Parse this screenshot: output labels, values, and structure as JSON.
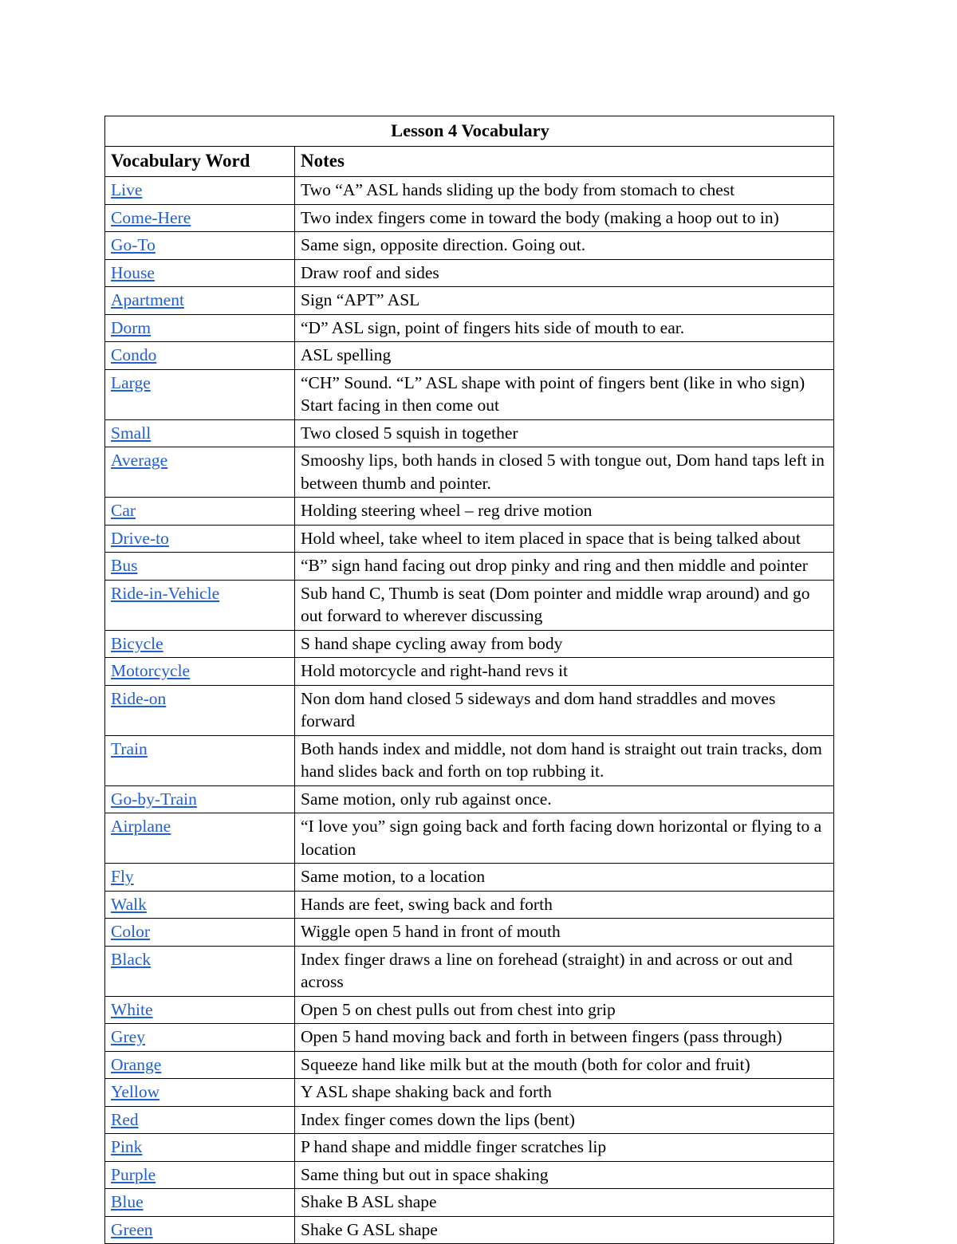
{
  "document": {
    "title": "Lesson 4 Vocabulary",
    "link_color": "#1f5fd0",
    "text_color": "#000000",
    "border_color": "#000000",
    "background_color": "#ffffff"
  },
  "table": {
    "title": "Lesson 4 Vocabulary",
    "columns": [
      {
        "label": "Vocabulary Word"
      },
      {
        "label": "Notes"
      }
    ],
    "rows": [
      {
        "word": "Live",
        "notes": "Two “A” ASL hands sliding up the body from stomach to chest"
      },
      {
        "word": "Come-Here",
        "notes": "Two index fingers come in toward the body (making a hoop out to in)"
      },
      {
        "word": "Go-To",
        "notes": "Same sign, opposite direction.  Going out."
      },
      {
        "word": "House",
        "notes": "Draw roof and sides"
      },
      {
        "word": "Apartment",
        "notes": "Sign “APT” ASL"
      },
      {
        "word": "Dorm",
        "notes": "“D” ASL sign, point of fingers hits side of mouth to ear."
      },
      {
        "word": "Condo",
        "notes": "ASL spelling"
      },
      {
        "word": "Large",
        "notes": "“CH” Sound. “L” ASL shape with point of fingers bent (like in who sign) Start facing in then come out"
      },
      {
        "word": "Small",
        "notes": "Two closed 5 squish in together"
      },
      {
        "word": "Average",
        "notes": "Smooshy lips, both hands in closed 5 with tongue out, Dom hand taps left in between thumb and pointer."
      },
      {
        "word": "Car",
        "notes": "Holding steering wheel – reg drive motion"
      },
      {
        "word": "Drive-to",
        "notes": "Hold wheel, take wheel to item placed in space that is being talked about"
      },
      {
        "word": "Bus",
        "notes": "“B” sign hand facing out drop pinky and ring and then middle and pointer"
      },
      {
        "word": "Ride-in-Vehicle",
        "notes": "Sub hand C, Thumb is seat (Dom pointer and middle wrap around) and go out forward to wherever discussing"
      },
      {
        "word": "Bicycle",
        "notes": "S hand shape cycling away from body"
      },
      {
        "word": "Motorcycle",
        "notes": "Hold motorcycle and right-hand revs it"
      },
      {
        "word": "Ride-on",
        "notes": "Non dom hand closed 5 sideways and dom hand straddles and moves forward"
      },
      {
        "word": "Train",
        "notes": "Both hands index and middle, not dom hand is straight out train tracks, dom hand slides back and forth on top rubbing it."
      },
      {
        "word": "Go-by-Train",
        "notes": "Same motion, only rub against once."
      },
      {
        "word": "Airplane",
        "notes": "“I love you” sign going back and forth facing down horizontal or flying to a location"
      },
      {
        "word": "Fly",
        "notes": "Same motion, to a location"
      },
      {
        "word": "Walk",
        "notes": "Hands are feet, swing back and forth"
      },
      {
        "word": "Color",
        "notes": "Wiggle open 5 hand in front of mouth"
      },
      {
        "word": "Black",
        "notes": "Index finger draws a line on forehead (straight) in and across or out and across"
      },
      {
        "word": "White",
        "notes": "Open 5 on chest pulls out from chest into grip"
      },
      {
        "word": "Grey",
        "notes": "Open 5 hand moving back and forth in between fingers (pass through)"
      },
      {
        "word": "Orange",
        "notes": "Squeeze hand like milk but at the mouth (both for color and fruit)"
      },
      {
        "word": "Yellow",
        "notes": "Y ASL shape shaking back and forth"
      },
      {
        "word": "Red",
        "notes": "Index finger comes down the lips (bent)"
      },
      {
        "word": "Pink",
        "notes": "P hand shape and middle finger scratches lip"
      },
      {
        "word": "Purple",
        "notes": "Same thing but out in space shaking"
      },
      {
        "word": "Blue",
        "notes": "Shake B ASL shape"
      },
      {
        "word": "Green",
        "notes": "Shake G ASL shape"
      }
    ]
  }
}
